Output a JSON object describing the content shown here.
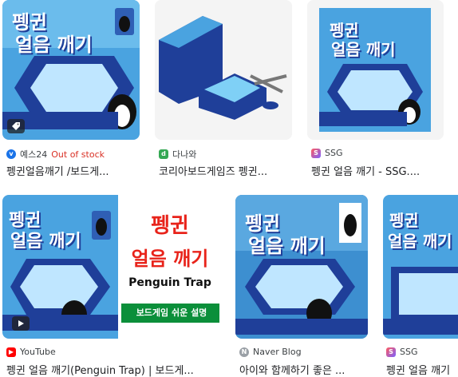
{
  "results": [
    {
      "source": "예스24",
      "status": "Out of stock",
      "title": "펭귄얼음깨기 /보드게...",
      "favicon": "yes24-icon",
      "favicon_color": "#1a73e8"
    },
    {
      "source": "다나와",
      "title": "코리아보드게임즈 펭귄...",
      "favicon": "danawa-icon",
      "favicon_color": "#34a853"
    },
    {
      "source": "SSG",
      "title": "펭귄 얼음 깨기 - SSG....",
      "favicon": "ssg-icon",
      "favicon_color": "#ea4335"
    },
    {
      "source": "YouTube",
      "title": "펭귄 얼음 깨기(Penguin Trap) | 보드게...",
      "favicon": "youtube-icon",
      "favicon_color": "#ff0000",
      "panel": {
        "line1": "펭귄",
        "line2": "얼음 깨기",
        "line3": "Penguin Trap",
        "banner": "보드게임 쉬운 설명"
      }
    },
    {
      "source": "Naver Blog",
      "title": "아이와 함께하기 좋은 ...",
      "favicon": "naver-blog-icon",
      "favicon_color": "#9aa0a6"
    },
    {
      "source": "SSG",
      "title": "펭귄 얼음 깨기",
      "favicon": "ssg-icon",
      "favicon_color": "#ea4335"
    }
  ],
  "box_art": {
    "title_line1": "펭귄",
    "title_line2": "얼음 깨기"
  }
}
